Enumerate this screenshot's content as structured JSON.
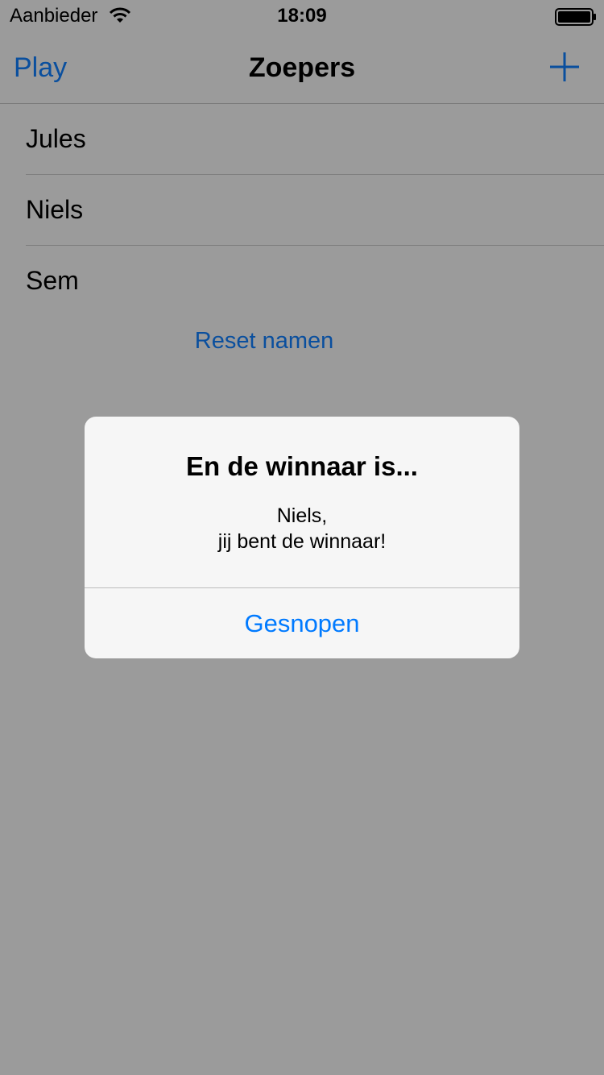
{
  "status_bar": {
    "carrier": "Aanbieder",
    "time": "18:09",
    "wifi_icon": "wifi-icon",
    "battery_icon": "battery-full-icon"
  },
  "nav_bar": {
    "left_button": "Play",
    "title": "Zoepers",
    "right_icon": "plus-icon"
  },
  "list": {
    "items": [
      "Jules",
      "Niels",
      "Sem"
    ]
  },
  "reset_link": "Reset namen",
  "alert": {
    "title": "En de winnaar is...",
    "message_lines": [
      "Niels,",
      "jij bent de winnaar!"
    ],
    "button": "Gesnopen"
  },
  "colors": {
    "dimmed_background": "#9b9b9b",
    "tint_dimmed": "#0a4f9e",
    "alert_button": "#007aff",
    "alert_background": "#f6f6f6"
  }
}
